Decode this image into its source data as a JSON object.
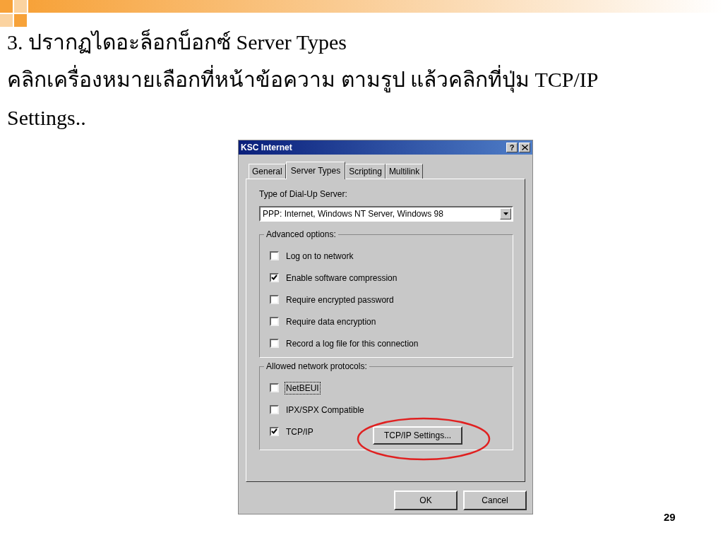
{
  "slide": {
    "title": "3. ปรากฏไดอะล็อกบ็อกซ์ Server Types",
    "instruction": "คลิกเครื่องหมายเลือกที่หน้าข้อความ ตามรูป แล้วคลิกที่ปุ่ม TCP/IP Settings..",
    "page_number": "29"
  },
  "dialog": {
    "title": "KSC Internet",
    "help_button": "?",
    "tabs": [
      {
        "label": "General",
        "selected": false
      },
      {
        "label": "Server Types",
        "selected": true
      },
      {
        "label": "Scripting",
        "selected": false
      },
      {
        "label": "Multilink",
        "selected": false
      }
    ],
    "server_type_label": "Type of Dial-Up Server:",
    "server_type_value": "PPP: Internet, Windows NT Server, Windows 98",
    "advanced_options": {
      "label": "Advanced options:",
      "options": [
        {
          "label": "Log on to network",
          "checked": false
        },
        {
          "label": "Enable software compression",
          "checked": true
        },
        {
          "label": "Require encrypted password",
          "checked": false
        },
        {
          "label": "Require data encryption",
          "checked": false
        },
        {
          "label": "Record a log file for this connection",
          "checked": false
        }
      ]
    },
    "protocols": {
      "label": "Allowed network protocols:",
      "options": [
        {
          "label": "NetBEUI",
          "checked": false,
          "focused": true
        },
        {
          "label": "IPX/SPX Compatible",
          "checked": false,
          "focused": false
        },
        {
          "label": "TCP/IP",
          "checked": true,
          "focused": false
        }
      ],
      "settings_button": "TCP/IP Settings..."
    },
    "buttons": [
      "OK",
      "Cancel"
    ]
  }
}
